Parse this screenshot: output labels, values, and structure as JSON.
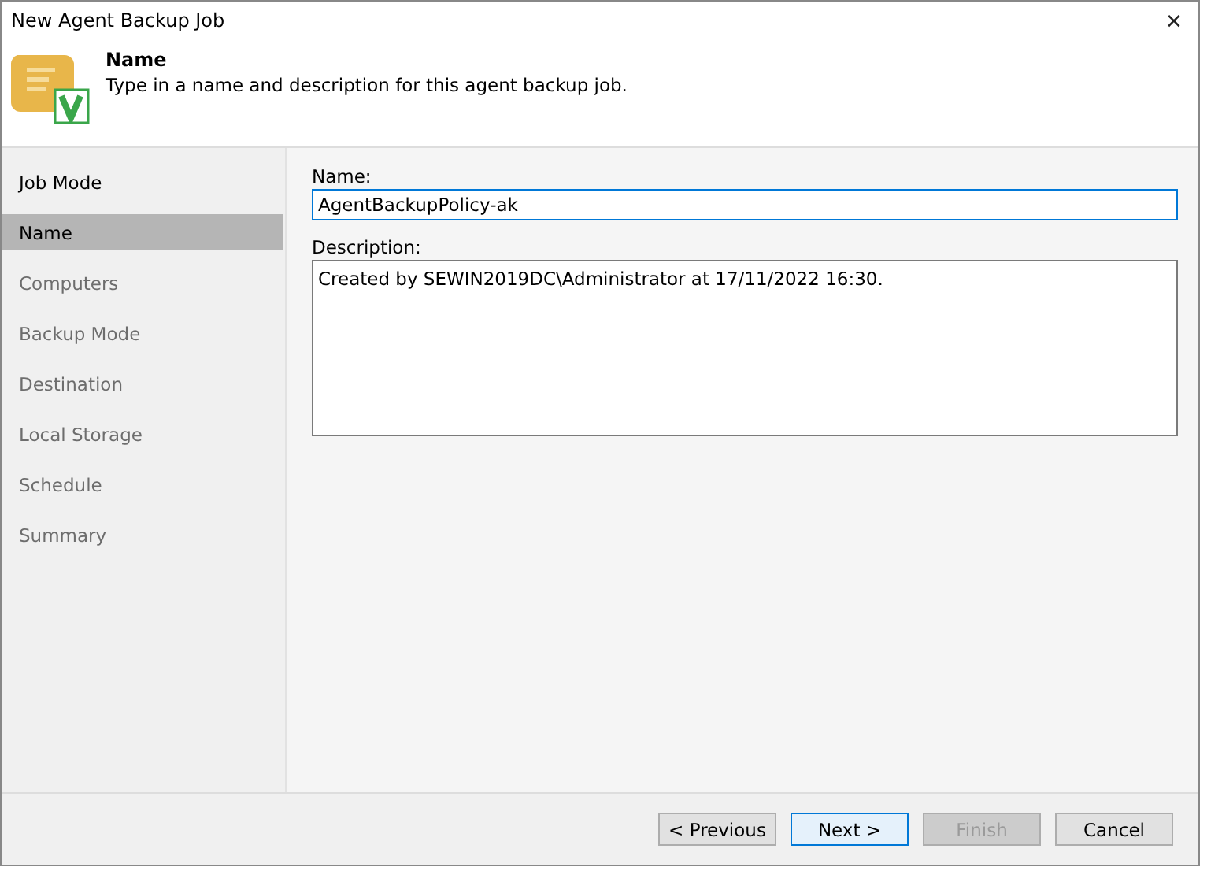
{
  "window": {
    "title": "New Agent Backup Job",
    "close": "✕"
  },
  "header": {
    "title": "Name",
    "subtitle": "Type in a name and description for this agent backup job."
  },
  "steps": [
    {
      "label": "Job Mode",
      "selected": false,
      "disabled": false
    },
    {
      "label": "Name",
      "selected": true,
      "disabled": false
    },
    {
      "label": "Computers",
      "selected": false,
      "disabled": true
    },
    {
      "label": "Backup Mode",
      "selected": false,
      "disabled": true
    },
    {
      "label": "Destination",
      "selected": false,
      "disabled": true
    },
    {
      "label": "Local Storage",
      "selected": false,
      "disabled": true
    },
    {
      "label": "Schedule",
      "selected": false,
      "disabled": true
    },
    {
      "label": "Summary",
      "selected": false,
      "disabled": true
    }
  ],
  "form": {
    "name_label": "Name:",
    "name_value": "AgentBackupPolicy-ak",
    "description_label": "Description:",
    "description_value": "Created by SEWIN2019DC\\Administrator at 17/11/2022 16:30."
  },
  "buttons": [
    {
      "label": "< Previous",
      "disabled": false,
      "focused": false
    },
    {
      "label": "Next >",
      "disabled": false,
      "focused": true
    },
    {
      "label": "Finish",
      "disabled": true,
      "focused": false
    },
    {
      "label": "Cancel",
      "disabled": false,
      "focused": false
    }
  ]
}
